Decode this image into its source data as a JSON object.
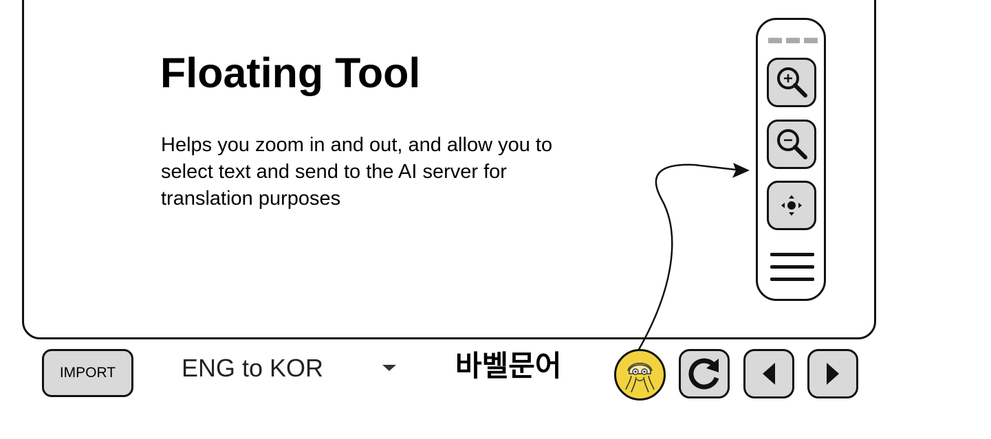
{
  "main": {
    "title": "Floating Tool",
    "description": "Helps you zoom in and out, and allow you to select text and send to the AI server for translation purposes"
  },
  "floating_tool": {
    "buttons": [
      {
        "icon": "zoom-in-icon"
      },
      {
        "icon": "zoom-out-icon"
      },
      {
        "icon": "move-icon"
      }
    ],
    "menu_icon": "hamburger-menu-icon"
  },
  "bottom_bar": {
    "import_label": "IMPORT",
    "language_value": "ENG to KOR",
    "brand": "바벨문어",
    "avatar_icon": "octopus-mascot-icon",
    "refresh_icon": "refresh-icon",
    "prev_icon": "previous-page-icon",
    "next_icon": "next-page-icon"
  },
  "colors": {
    "button_fill": "#d9d9d9",
    "outline": "#111111",
    "avatar_yellow": "#f2d33f",
    "drag_handle": "#aaaaaa"
  }
}
